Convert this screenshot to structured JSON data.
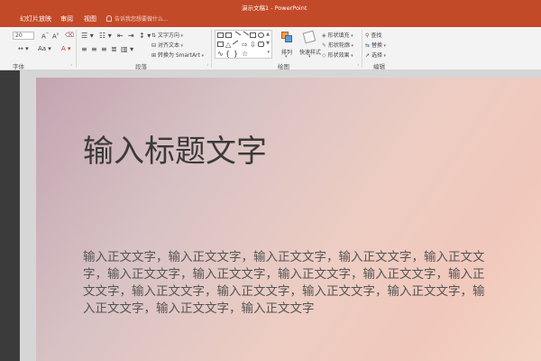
{
  "window": {
    "title": "演示文稿1 - PowerPoint"
  },
  "ribbon_tabs": [
    {
      "label": "幻灯片放映"
    },
    {
      "label": "审阅"
    },
    {
      "label": "视图"
    }
  ],
  "tell_me": {
    "placeholder": "告诉我您想要做什么..."
  },
  "ribbon": {
    "font_group_label": "字体",
    "paragraph_group_label": "段落",
    "drawing_group_label": "绘图",
    "editing_group_label": "编辑",
    "font_size": "20",
    "text_direction": "文字方向",
    "align_text": "对齐文本",
    "convert_smartart": "转换为 SmartArt",
    "arrange": "排列",
    "quick_styles": "快速样式",
    "shape_fill": "形状填充",
    "shape_outline": "形状轮廓",
    "shape_effects": "形状效果",
    "find": "查找",
    "replace": "替换",
    "select": "选择"
  },
  "slide": {
    "title": "输入标题文字",
    "body": "输入正文文字，输入正文文字，输入正文文字，输入正文文字，输入正文文字，输入正文文字，输入正文文字，输入正文文字，输入正文文字，输入正文文字，输入正文文字，输入正文文字，输入正文文字，输入正文文字，输入正文文字，输入正文文字，输入正文文字"
  }
}
